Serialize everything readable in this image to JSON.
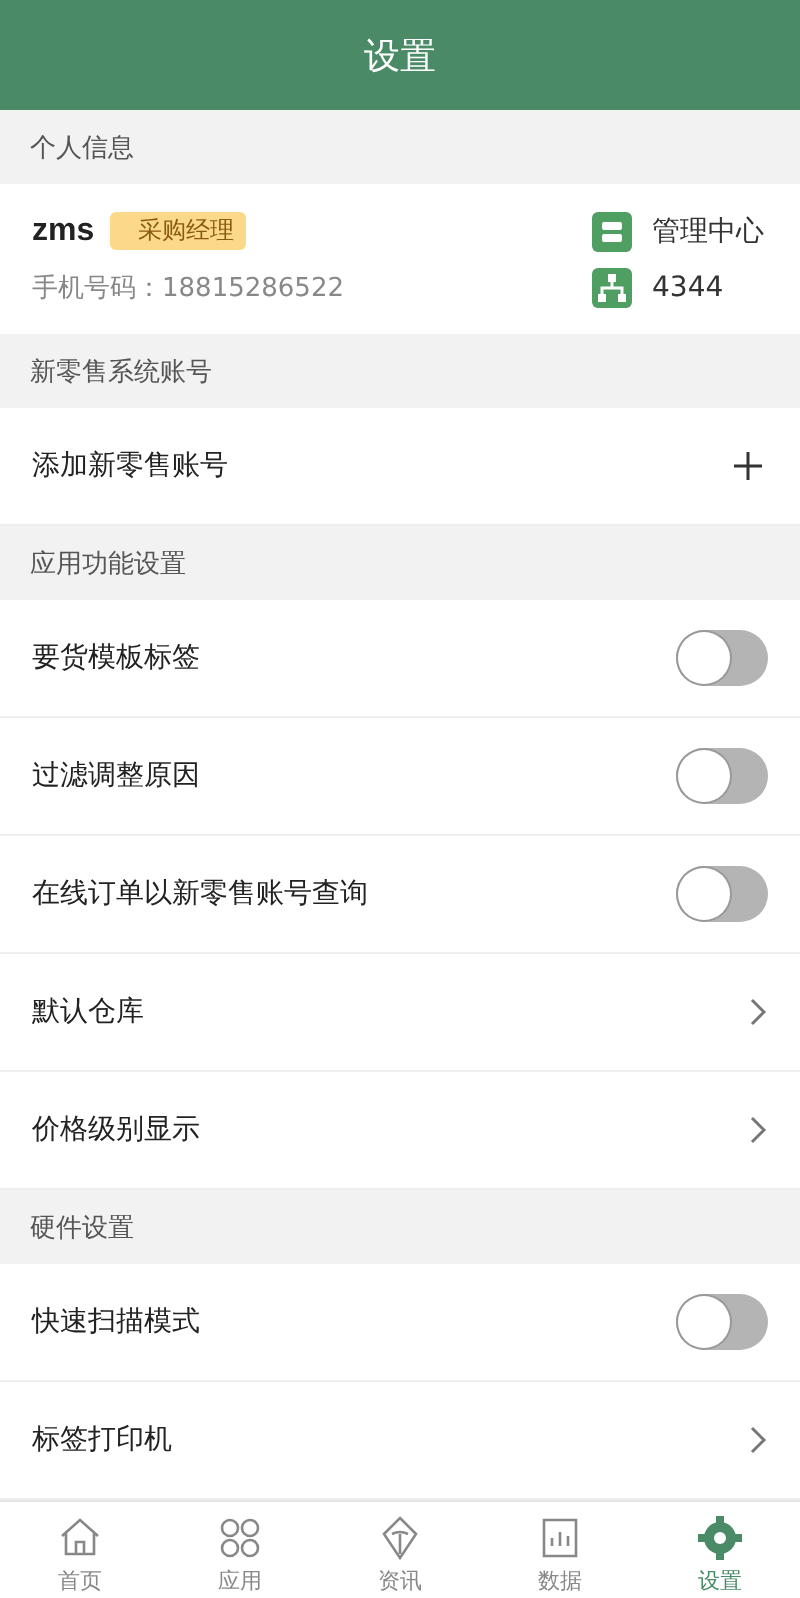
{
  "header": {
    "title": "设置"
  },
  "profile": {
    "section_title": "个人信息",
    "name": "zms",
    "role_badge": "采购经理",
    "phone": "手机号码：18815286522",
    "links": [
      {
        "kind": "store",
        "label": "管理中心"
      },
      {
        "kind": "org",
        "label": "4344"
      }
    ]
  },
  "sections": [
    {
      "title": "新零售系统账号",
      "items": [
        {
          "kind": "add",
          "label": "添加新零售账号"
        }
      ]
    },
    {
      "title": "应用功能设置",
      "items": [
        {
          "kind": "toggle",
          "label": "要货模板标签",
          "on": false
        },
        {
          "kind": "toggle",
          "label": "过滤调整原因",
          "on": false
        },
        {
          "kind": "toggle",
          "label": "在线订单以新零售账号查询",
          "on": false
        },
        {
          "kind": "chevron",
          "label": "默认仓库"
        },
        {
          "kind": "chevron",
          "label": "价格级别显示"
        }
      ]
    },
    {
      "title": "硬件设置",
      "items": [
        {
          "kind": "toggle",
          "label": "快速扫描模式",
          "on": false
        },
        {
          "kind": "chevron",
          "label": "标签打印机"
        }
      ]
    }
  ],
  "tab_bar": [
    {
      "kind": "home",
      "label": "首页",
      "selected": false
    },
    {
      "kind": "apps",
      "label": "应用",
      "selected": false
    },
    {
      "kind": "news",
      "label": "资讯",
      "selected": false
    },
    {
      "kind": "data",
      "label": "数据",
      "selected": false
    },
    {
      "kind": "gear",
      "label": "设置",
      "selected": true
    }
  ]
}
